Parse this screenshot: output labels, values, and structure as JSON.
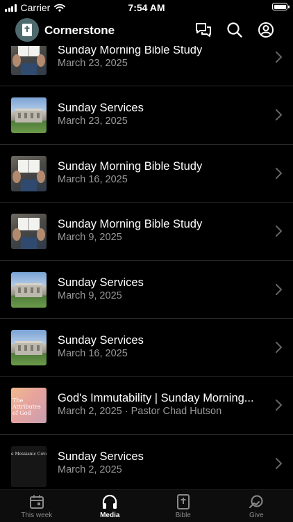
{
  "status_bar": {
    "carrier": "Carrier",
    "time": "7:54 AM"
  },
  "header": {
    "title": "Cornerstone"
  },
  "items": [
    {
      "title": "Sunday Morning Bible Study",
      "subtitle": "March 23, 2025",
      "thumbnail": "bible"
    },
    {
      "title": "Sunday Services",
      "subtitle": "March 23, 2025",
      "thumbnail": "church"
    },
    {
      "title": "Sunday Morning Bible Study",
      "subtitle": "March 16, 2025",
      "thumbnail": "bible"
    },
    {
      "title": "Sunday Morning Bible Study",
      "subtitle": "March 9, 2025",
      "thumbnail": "bible"
    },
    {
      "title": "Sunday Services",
      "subtitle": "March 9, 2025",
      "thumbnail": "church"
    },
    {
      "title": "Sunday Services",
      "subtitle": "March 16, 2025",
      "thumbnail": "church"
    },
    {
      "title": "God's Immutability | Sunday Morning...",
      "subtitle": "March 2, 2025 · Pastor Chad Hutson",
      "thumbnail": "attributes",
      "thumbnail_text": "The Attributes of God"
    },
    {
      "title": "Sunday Services",
      "subtitle": "March 2, 2025",
      "thumbnail": "messianic",
      "thumbnail_text": "e Messianic Cove"
    }
  ],
  "tabs": [
    {
      "label": "This week",
      "icon": "calendar-icon",
      "active": false
    },
    {
      "label": "Media",
      "icon": "headphones-icon",
      "active": true
    },
    {
      "label": "Bible",
      "icon": "bible-icon",
      "active": false
    },
    {
      "label": "Give",
      "icon": "give-icon",
      "active": false
    }
  ],
  "colors": {
    "background": "#000000",
    "secondary_text": "#9a9a9a",
    "active_tab": "#ffffff",
    "inactive_tab": "#8a8a8a",
    "logo_bg": "#4f6a6d"
  }
}
